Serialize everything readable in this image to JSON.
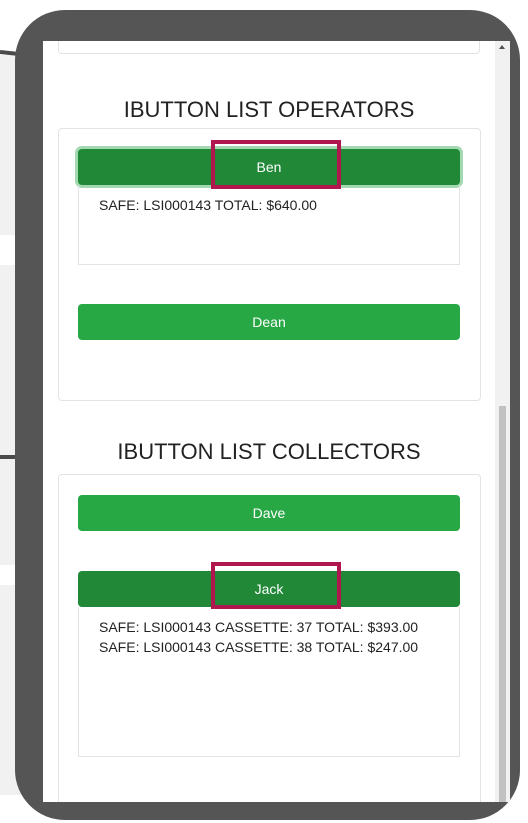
{
  "operators": {
    "title": "IBUTTON LIST OPERATORS",
    "buttons": [
      {
        "name": "Ben",
        "active": true,
        "highlighted": true,
        "details": [
          "SAFE: LSI000143 TOTAL: $640.00"
        ]
      },
      {
        "name": "Dean",
        "active": false
      }
    ]
  },
  "collectors": {
    "title": "IBUTTON LIST COLLECTORS",
    "buttons": [
      {
        "name": "Dave",
        "active": false
      },
      {
        "name": "Jack",
        "active": true,
        "highlighted": true,
        "details": [
          "SAFE: LSI000143 CASSETTE: 37 TOTAL: $393.00",
          "SAFE: LSI000143 CASSETTE: 38 TOTAL: $247.00"
        ]
      }
    ]
  },
  "colors": {
    "button_green": "#28a745",
    "button_active_green": "#218838",
    "highlight_border": "#b0174f",
    "device_frame": "#555555"
  },
  "icons": {
    "scroll_up": "scroll-up-arrow-icon"
  }
}
